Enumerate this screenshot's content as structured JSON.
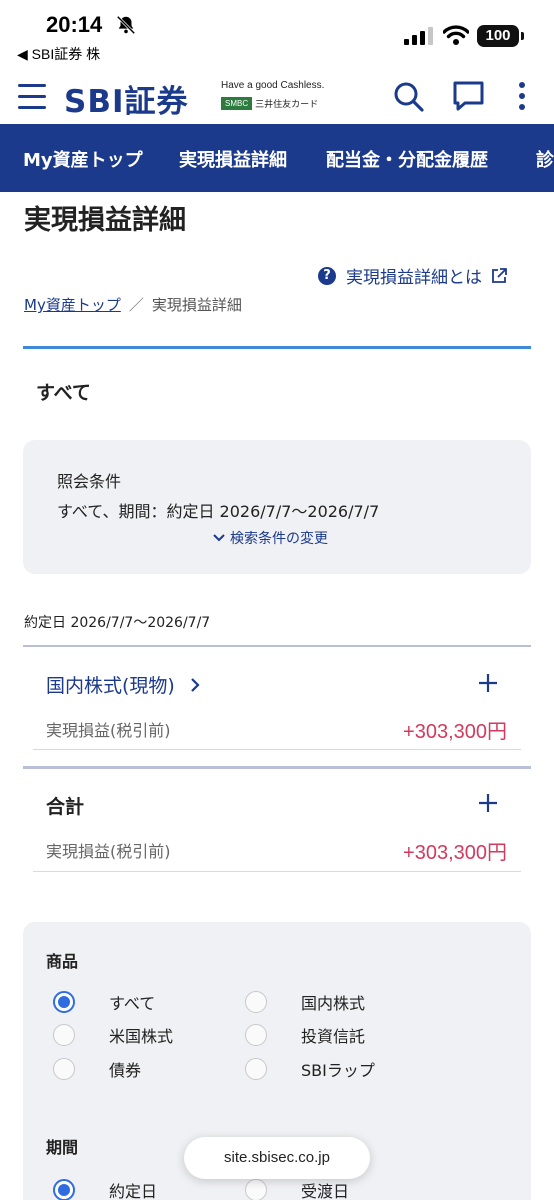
{
  "status_bar": {
    "time": "20:14",
    "back_app": "◀ SBI証券 株",
    "battery": "100"
  },
  "header": {
    "logo": "SBI証券",
    "tagline": "Have a good Cashless.",
    "smbc": "SMBC",
    "card_name": "三井住友カード"
  },
  "nav": {
    "tabs": [
      "My資産トップ",
      "実現損益詳細",
      "配当金・分配金履歴",
      "診"
    ]
  },
  "page": {
    "title": "実現損益詳細",
    "help_link": "実現損益詳細とは",
    "breadcrumb": {
      "home": "My資産トップ",
      "separator": "／",
      "current": "実現損益詳細"
    },
    "tab_all": "すべて"
  },
  "conditions": {
    "title": "照会条件",
    "value": "すべて、期間：約定日 2026/7/7〜2026/7/7",
    "change_link": "検索条件の変更"
  },
  "period_label": "約定日 2026/7/7〜2026/7/7",
  "sections": [
    {
      "head": "国内株式(現物)",
      "label": "実現損益(税引前)",
      "value": "+303,300円"
    },
    {
      "head": "合計",
      "label": "実現損益(税引前)",
      "value": "+303,300円"
    }
  ],
  "filters": {
    "product_title": "商品",
    "products": [
      "すべて",
      "国内株式",
      "米国株式",
      "投資信託",
      "債券",
      "SBIラップ"
    ],
    "period_title": "期間",
    "periods": [
      "約定日",
      "受渡日"
    ]
  },
  "url": "site.sbisec.co.jp",
  "colors": {
    "brand": "#1b3a8c",
    "profit": "#d23a5e",
    "accent_rule": "#3d8ad8",
    "radio_selected": "#2f6ce0"
  }
}
